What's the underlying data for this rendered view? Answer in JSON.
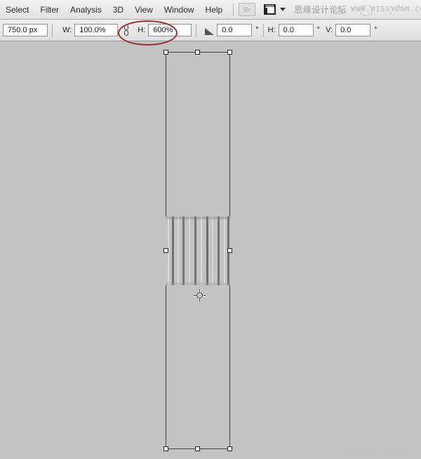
{
  "app": {
    "name": "Adobe Photoshop",
    "mode": "free-transform"
  },
  "menubar": {
    "items": [
      {
        "label": "Select"
      },
      {
        "label": "Filter"
      },
      {
        "label": "Analysis"
      },
      {
        "label": "3D"
      },
      {
        "label": "View"
      },
      {
        "label": "Window"
      },
      {
        "label": "Help"
      }
    ],
    "bridge_button_label": "Br",
    "screen_mode_icon": "screen-mode-icon",
    "screen_mode_caret": "chevron-down-icon",
    "watermark_cn": "思缘设计论坛",
    "watermark_en": "WWW.MISSYUAN.COM"
  },
  "options_bar": {
    "reference_field": {
      "value": "750.0 px"
    },
    "width": {
      "label": "W:",
      "value": "100.0%"
    },
    "link_icon": "link-constraint-icon",
    "height": {
      "label": "H:",
      "value": "600%"
    },
    "angle_icon": "rotate-angle-icon",
    "angle": {
      "value": "0.0",
      "unit": "°"
    },
    "skew_h": {
      "label": "H:",
      "value": "0.0",
      "unit": "°"
    },
    "skew_v": {
      "label": "V:",
      "value": "0.0",
      "unit": "°"
    }
  },
  "annotation": {
    "type": "red-ellipse-highlight",
    "target": "height-percent-field",
    "color": "#9c2b2b"
  },
  "canvas": {
    "background_color": "#c3c3c3",
    "transform_box": {
      "handles": [
        "top-left",
        "top-center",
        "top-right",
        "middle-left",
        "middle-right",
        "bottom-left",
        "bottom-center",
        "bottom-right"
      ],
      "reference_point_icon": "transform-reference-point-icon"
    },
    "layer_content": {
      "description": "vertical motion-blurred grayscale noise",
      "palette": [
        "#2b2b2b",
        "#6e6e6e",
        "#a8a8a8",
        "#e8e8e8"
      ]
    },
    "watermark": "www.missyuan.com"
  }
}
